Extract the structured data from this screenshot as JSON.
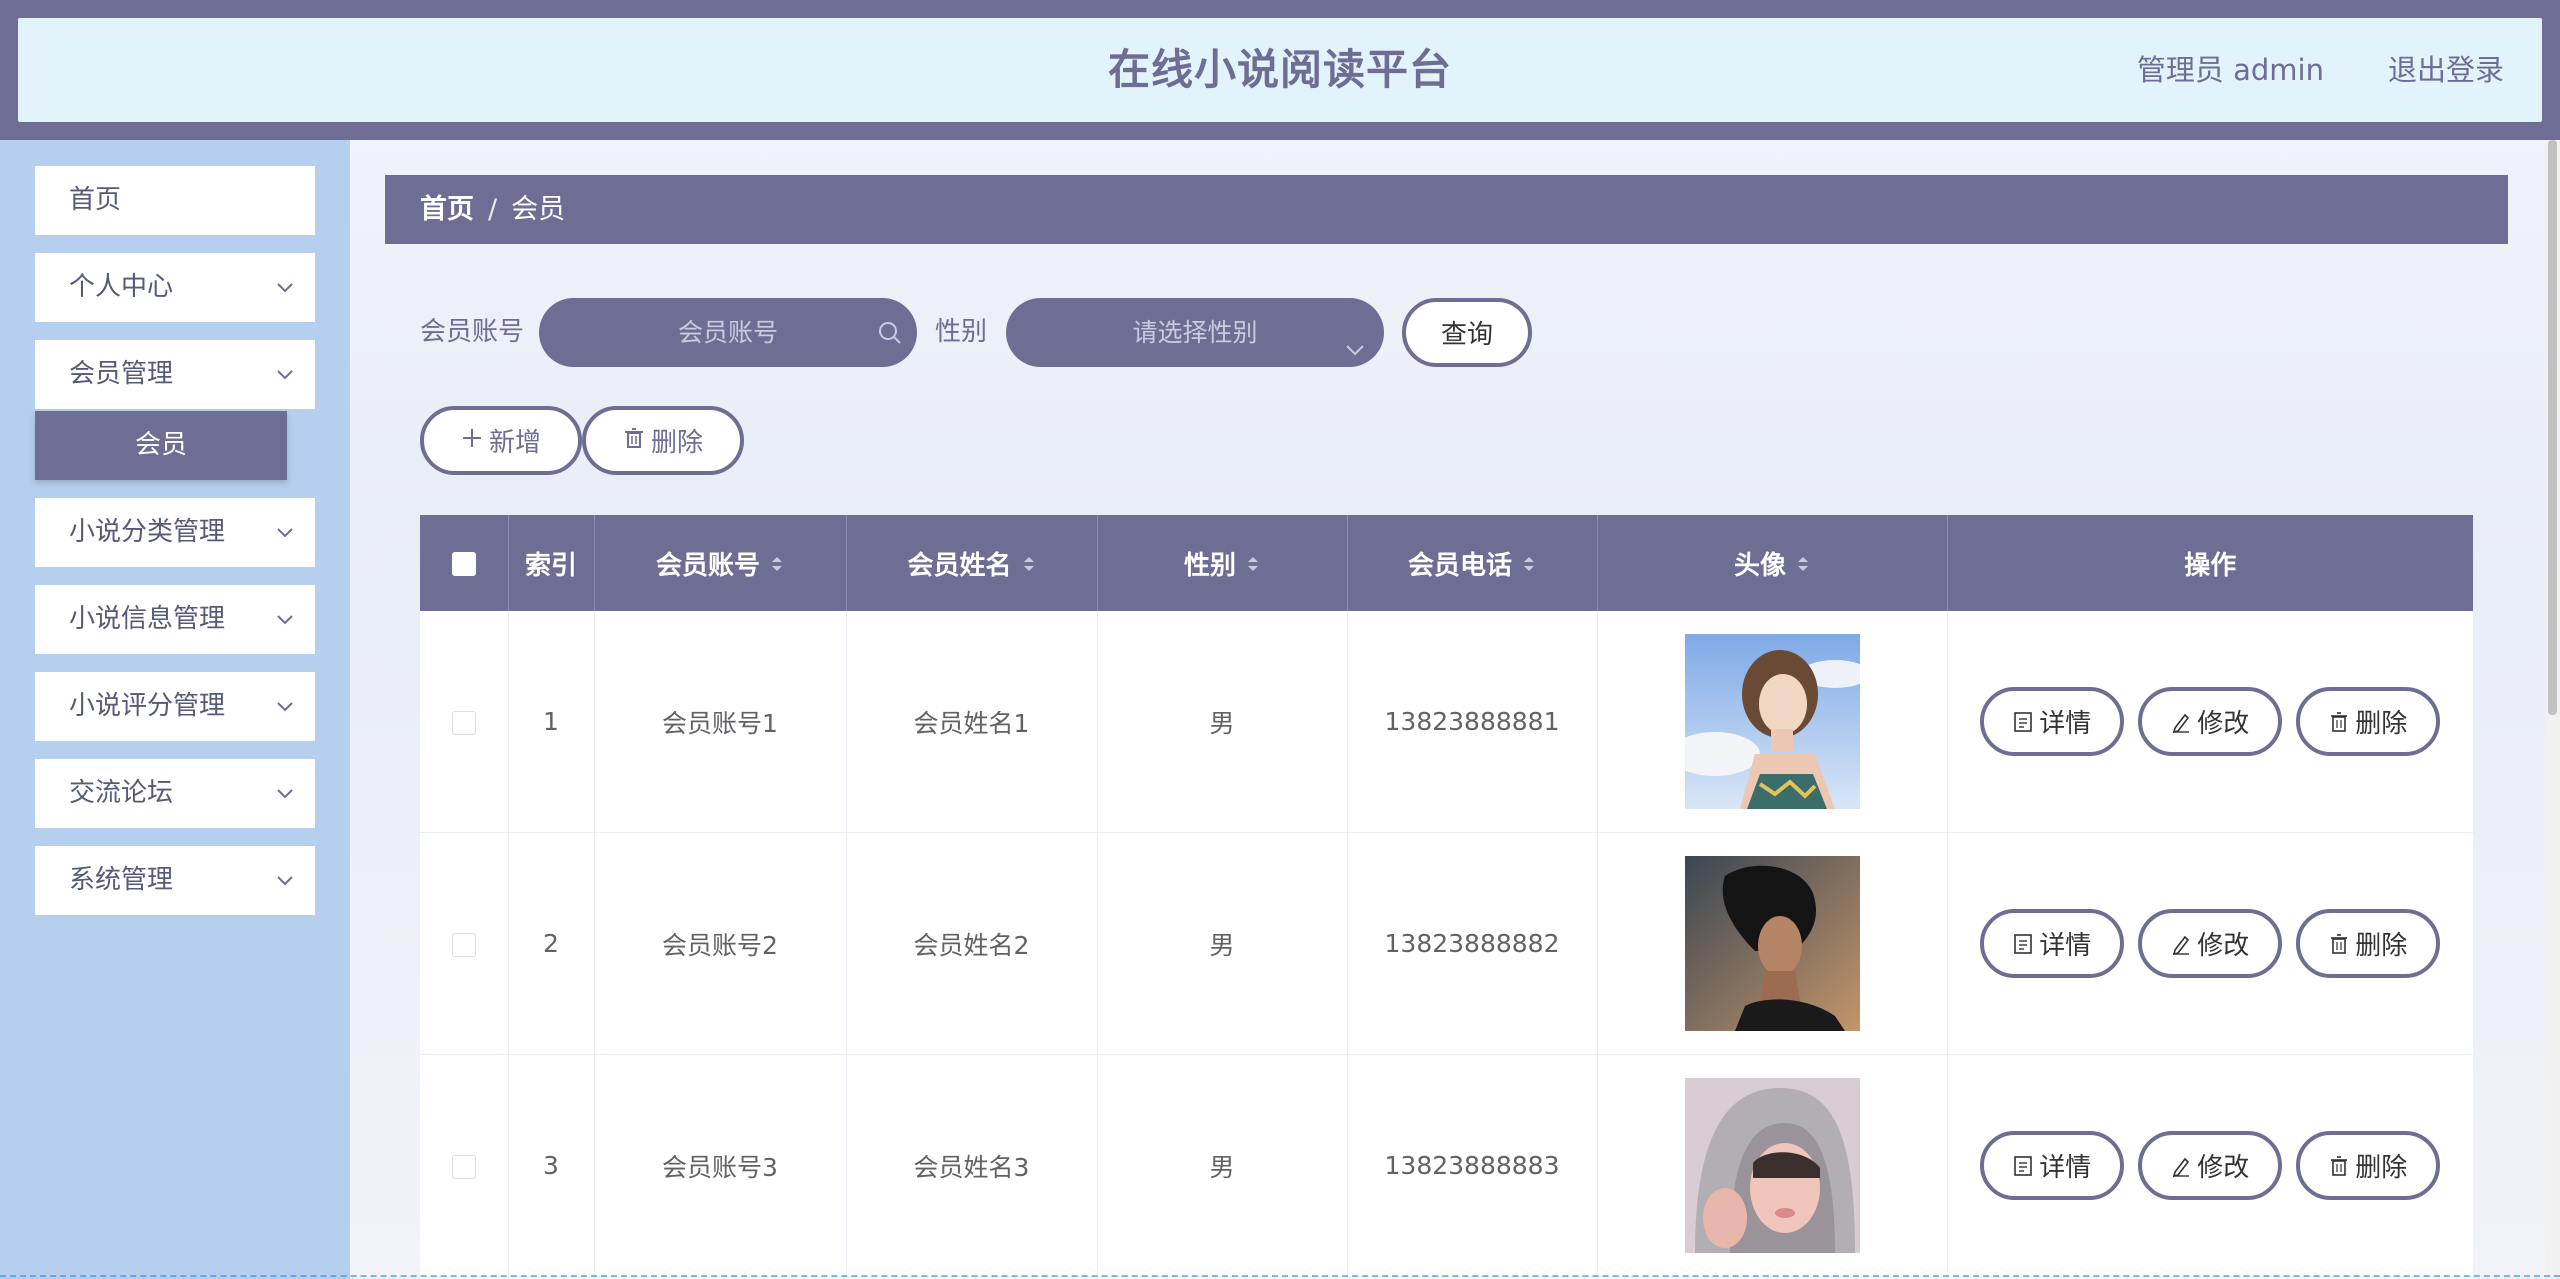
{
  "header": {
    "title": "在线小说阅读平台",
    "user": "管理员 admin",
    "logout": "退出登录"
  },
  "sidebar": {
    "items": [
      {
        "label": "首页",
        "has_children": false
      },
      {
        "label": "个人中心",
        "has_children": true
      },
      {
        "label": "会员管理",
        "has_children": true,
        "expanded": true
      },
      {
        "label": "小说分类管理",
        "has_children": true
      },
      {
        "label": "小说信息管理",
        "has_children": true
      },
      {
        "label": "小说评分管理",
        "has_children": true
      },
      {
        "label": "交流论坛",
        "has_children": true
      },
      {
        "label": "系统管理",
        "has_children": true
      }
    ],
    "active_sub": "会员"
  },
  "breadcrumb": {
    "home": "首页",
    "separator": "/",
    "current": "会员"
  },
  "search": {
    "account_label": "会员账号",
    "account_placeholder": "会员账号",
    "gender_label": "性别",
    "gender_placeholder": "请选择性别",
    "query_button": "查询"
  },
  "actions": {
    "add": "新增",
    "delete": "删除"
  },
  "table": {
    "headers": [
      "",
      "索引",
      "会员账号",
      "会员姓名",
      "性别",
      "会员电话",
      "头像",
      "操作"
    ],
    "rows": [
      {
        "index": "1",
        "account": "会员账号1",
        "name": "会员姓名1",
        "gender": "男",
        "phone": "13823888881",
        "avatar": "avatar-photo-1"
      },
      {
        "index": "2",
        "account": "会员账号2",
        "name": "会员姓名2",
        "gender": "男",
        "phone": "13823888882",
        "avatar": "avatar-photo-2"
      },
      {
        "index": "3",
        "account": "会员账号3",
        "name": "会员姓名3",
        "gender": "男",
        "phone": "13823888883",
        "avatar": "avatar-photo-3"
      }
    ],
    "row_actions": {
      "detail": "详情",
      "edit": "修改",
      "delete": "删除"
    }
  },
  "colors": {
    "primary": "#6e6d94",
    "header_bg": "#e3f3fc",
    "sidebar_bg": "#b7cfee"
  }
}
